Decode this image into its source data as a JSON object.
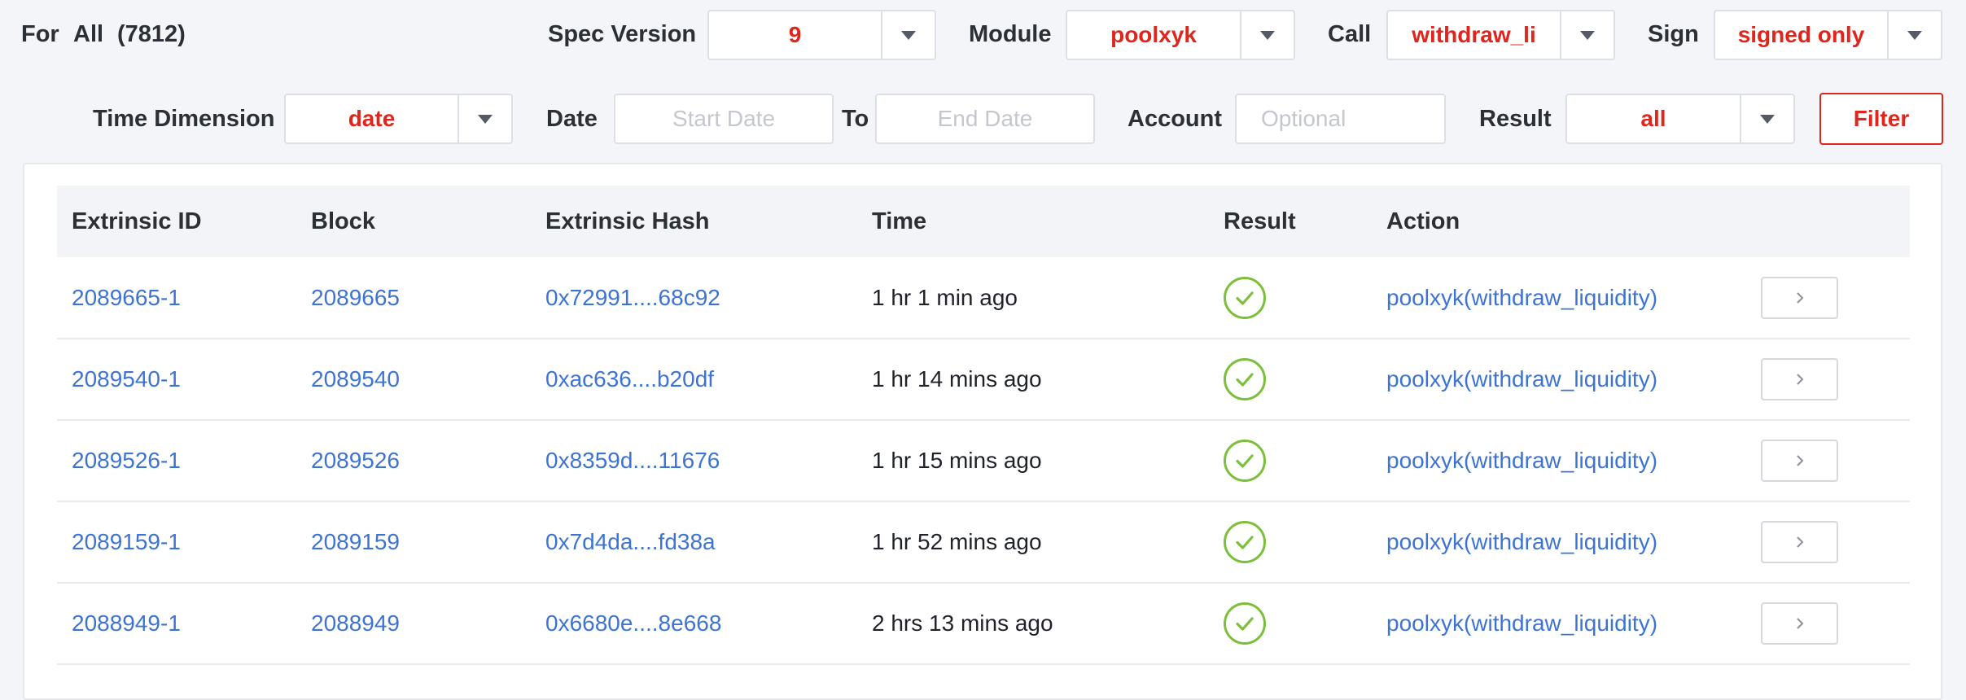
{
  "header": {
    "for_label": "For",
    "scope": "All",
    "count": "(7812)",
    "spec_version_label": "Spec Version",
    "spec_version_value": "9",
    "module_label": "Module",
    "module_value": "poolxyk",
    "call_label": "Call",
    "call_value": "withdraw_li",
    "sign_label": "Sign",
    "sign_value": "signed only"
  },
  "filters": {
    "time_dimension_label": "Time Dimension",
    "time_dimension_value": "date",
    "date_label": "Date",
    "start_placeholder": "Start Date",
    "to_label": "To",
    "end_placeholder": "End Date",
    "account_label": "Account",
    "account_placeholder": "Optional",
    "result_label": "Result",
    "result_value": "all",
    "filter_button": "Filter"
  },
  "table": {
    "columns": [
      "Extrinsic ID",
      "Block",
      "Extrinsic Hash",
      "Time",
      "Result",
      "Action"
    ],
    "rows": [
      {
        "id": "2089665-1",
        "block": "2089665",
        "hash": "0x72991....68c92",
        "time": "1 hr 1 min ago",
        "action": "poolxyk(withdraw_liquidity)"
      },
      {
        "id": "2089540-1",
        "block": "2089540",
        "hash": "0xac636....b20df",
        "time": "1 hr 14 mins ago",
        "action": "poolxyk(withdraw_liquidity)"
      },
      {
        "id": "2089526-1",
        "block": "2089526",
        "hash": "0x8359d....11676",
        "time": "1 hr 15 mins ago",
        "action": "poolxyk(withdraw_liquidity)"
      },
      {
        "id": "2089159-1",
        "block": "2089159",
        "hash": "0x7d4da....fd38a",
        "time": "1 hr 52 mins ago",
        "action": "poolxyk(withdraw_liquidity)"
      },
      {
        "id": "2088949-1",
        "block": "2088949",
        "hash": "0x6680e....8e668",
        "time": "2 hrs 13 mins ago",
        "action": "poolxyk(withdraw_liquidity)"
      }
    ]
  },
  "icons": {
    "result_ok": "check-circle-icon",
    "row_action": "chevron-right-icon",
    "dropdown": "caret-down-icon"
  },
  "colors": {
    "accent": "#e0251c",
    "link": "#3d74d4",
    "success": "#7cbf3a"
  }
}
